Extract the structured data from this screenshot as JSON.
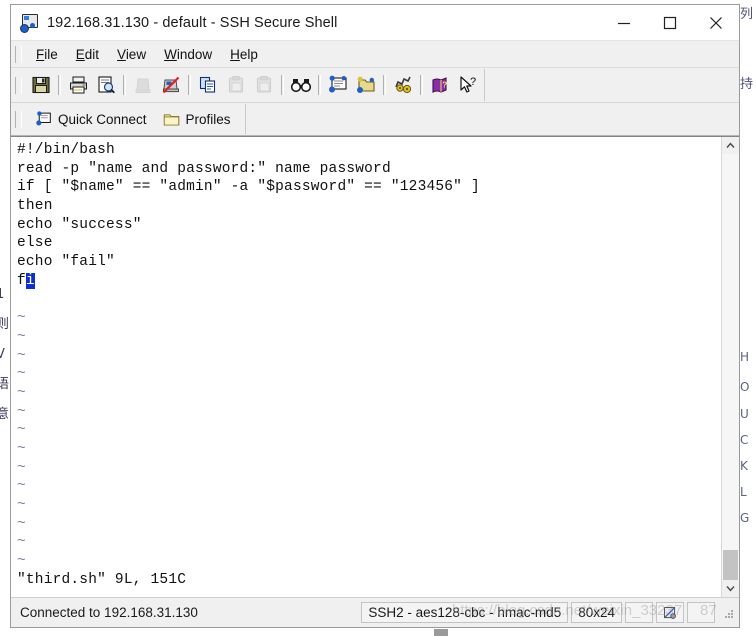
{
  "window": {
    "title": "192.168.31.130 - default - SSH Secure Shell",
    "icon": "ssh-terminal-icon",
    "controls": {
      "minimize": "—",
      "maximize": "□",
      "close": "✕"
    }
  },
  "menubar": {
    "items": [
      {
        "label": "File",
        "accel": "F"
      },
      {
        "label": "Edit",
        "accel": "E"
      },
      {
        "label": "View",
        "accel": "V"
      },
      {
        "label": "Window",
        "accel": "W"
      },
      {
        "label": "Help",
        "accel": "H"
      }
    ]
  },
  "toolbar": {
    "buttons": [
      {
        "name": "save-icon",
        "tooltip": "Save",
        "enabled": true
      },
      {
        "name": "print-icon",
        "tooltip": "Print",
        "enabled": true
      },
      {
        "name": "print-preview-icon",
        "tooltip": "Print Preview",
        "enabled": true
      },
      {
        "name": "connect-icon",
        "tooltip": "Connect",
        "enabled": false
      },
      {
        "name": "disconnect-icon",
        "tooltip": "Disconnect",
        "enabled": true
      },
      {
        "name": "copy-icon",
        "tooltip": "Copy",
        "enabled": true
      },
      {
        "name": "paste-icon",
        "tooltip": "Paste",
        "enabled": false
      },
      {
        "name": "paste-plain-icon",
        "tooltip": "Paste",
        "enabled": false
      },
      {
        "name": "find-icon",
        "tooltip": "Find",
        "enabled": true
      },
      {
        "name": "new-terminal-icon",
        "tooltip": "New Terminal",
        "enabled": true
      },
      {
        "name": "new-file-transfer-icon",
        "tooltip": "New File Transfer",
        "enabled": true
      },
      {
        "name": "settings-icon",
        "tooltip": "Settings",
        "enabled": true
      },
      {
        "name": "help-book-icon",
        "tooltip": "Help",
        "enabled": true
      },
      {
        "name": "context-help-icon",
        "tooltip": "Context Help",
        "enabled": true
      }
    ]
  },
  "quickbar": {
    "quick_connect": "Quick Connect",
    "profiles": "Profiles"
  },
  "terminal": {
    "lines": [
      "#!/bin/bash",
      "read -p \"name and password:\" name password",
      "if [ \"$name\" == \"admin\" -a \"$password\" == \"123456\" ]",
      "then",
      "echo \"success\"",
      "else",
      "echo \"fail\"",
      "f",
      ""
    ],
    "cursor_char": "i",
    "tilde_count": 14,
    "tilde_char": "~",
    "status_line": "\"third.sh\" 9L, 151C"
  },
  "statusbar": {
    "connection": "Connected to 192.168.31.130",
    "cipher": "SSH2 - aes128-cbc - hmac-md5",
    "size": "80x24",
    "trap_icon": "capture-icon"
  },
  "scrollbar": {
    "up_arrow": "⌃",
    "down_arrow": "⌄"
  },
  "background": {
    "left_glyphs": [
      "1",
      "则",
      "V",
      "语",
      "意"
    ],
    "right_glyphs": [
      "列",
      "持",
      "H",
      "O",
      "U",
      "C",
      "K",
      "L",
      "G"
    ]
  },
  "watermark": {
    "line1": "https://blog.csdn.net/weixin_33237",
    "line2": "87"
  },
  "colors": {
    "window_bg": "#f0f0f0",
    "terminal_bg": "#ffffff",
    "terminal_fg": "#101010",
    "cursor_bg": "#0c2fd4",
    "tilde_fg": "#7d7da0",
    "border": "#9b9b9b"
  }
}
